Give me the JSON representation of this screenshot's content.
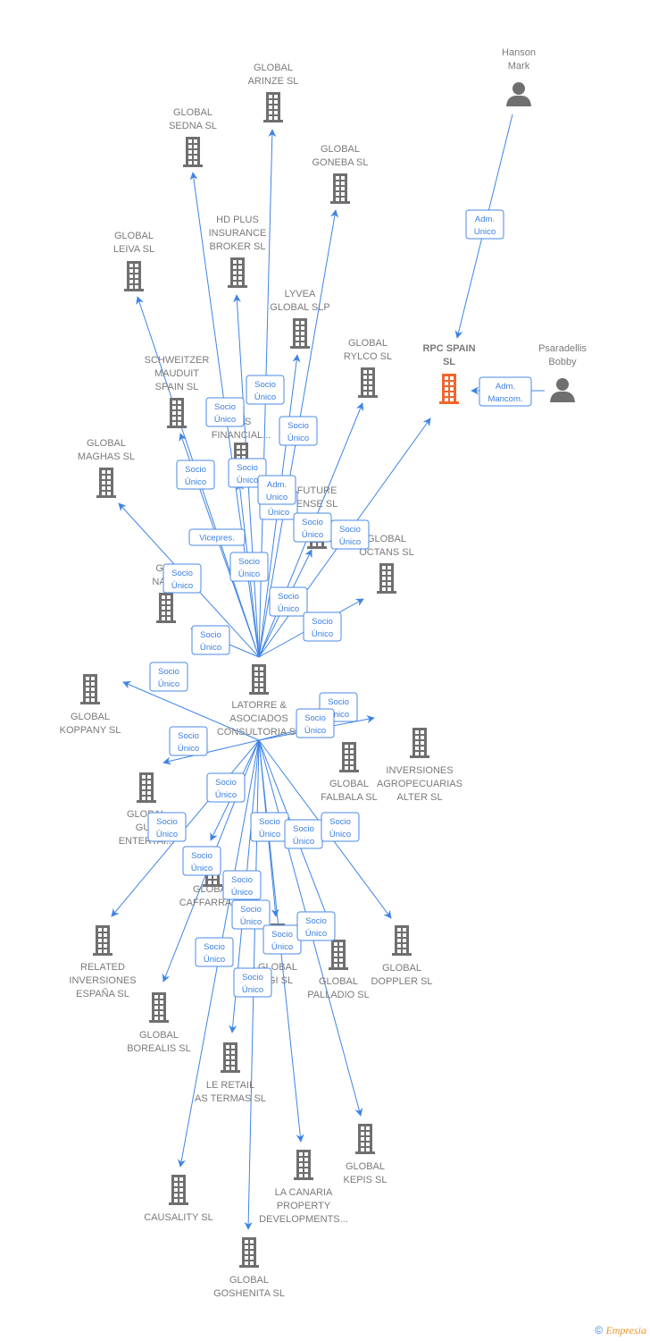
{
  "colors": {
    "edge": "#3f84e5",
    "company": "#6f6f6f",
    "highlight": "#f2652d",
    "person": "#6f6f6f"
  },
  "nodes": [
    {
      "id": "hub",
      "type": "company-icon",
      "lines": [
        "LATORRE &",
        "ASOCIADOS",
        "CONSULTORIA SL"
      ]
    },
    {
      "id": "arinze",
      "type": "company-icon",
      "lines": [
        "GLOBAL",
        "ARINZE  SL"
      ]
    },
    {
      "id": "sedna",
      "type": "company-icon",
      "lines": [
        "GLOBAL",
        "SEDNA  SL"
      ]
    },
    {
      "id": "goneba",
      "type": "company-icon",
      "lines": [
        "GLOBAL",
        "GONEBA  SL"
      ]
    },
    {
      "id": "hdplus",
      "type": "company-icon",
      "lines": [
        "HD PLUS",
        "INSURANCE",
        "BROKER  SL"
      ]
    },
    {
      "id": "leiva",
      "type": "company-icon",
      "lines": [
        "GLOBAL",
        "LEIVA  SL"
      ]
    },
    {
      "id": "lyvea",
      "type": "company-icon",
      "lines": [
        "LYVEA",
        "GLOBAL  SLP"
      ]
    },
    {
      "id": "rylco",
      "type": "company-icon",
      "lines": [
        "GLOBAL",
        "RYLCO  SL"
      ]
    },
    {
      "id": "rpc",
      "type": "company-icon-highlight",
      "lines": [
        "RPC  SPAIN",
        "SL"
      ]
    },
    {
      "id": "hanson",
      "type": "person-icon",
      "lines": [
        "Hanson",
        "Mark"
      ]
    },
    {
      "id": "psaradellis",
      "type": "person-icon",
      "lines": [
        "Psaradellis",
        "Bobby"
      ]
    },
    {
      "id": "schweitzer",
      "type": "company-icon",
      "lines": [
        "SCHWEITZER",
        "MAUDUIT",
        "SPAIN SL"
      ]
    },
    {
      "id": "financial",
      "type": "company-icon",
      "lines": [
        "O",
        "RES",
        "FINANCIAL..."
      ]
    },
    {
      "id": "maghas",
      "type": "company-icon",
      "lines": [
        "GLOBAL",
        "MAGHAS  SL"
      ]
    },
    {
      "id": "future",
      "type": "company-icon",
      "lines": [
        "FUTURE",
        "ENSE  SL"
      ]
    },
    {
      "id": "octans",
      "type": "company-icon",
      "lines": [
        "GLOBAL",
        "OCTANS  SL"
      ]
    },
    {
      "id": "nann",
      "type": "company-icon",
      "lines": [
        "GLO",
        "NANN"
      ]
    },
    {
      "id": "koppany",
      "type": "company-icon",
      "lines": [
        "GLOBAL",
        "KOPPANY  SL"
      ]
    },
    {
      "id": "alter",
      "type": "company-icon",
      "lines": [
        "INVERSIONES",
        "AGROPECUARIAS",
        "ALTER  SL"
      ]
    },
    {
      "id": "falbala",
      "type": "company-icon",
      "lines": [
        "GLOBAL",
        "FALBALA  SL"
      ]
    },
    {
      "id": "gud",
      "type": "company-icon",
      "lines": [
        "GLOBAL",
        "GUD",
        "ENTERTAI..."
      ]
    },
    {
      "id": "caffarra",
      "type": "company-icon",
      "lines": [
        "GLOBAL",
        "CAFFARRA SL"
      ]
    },
    {
      "id": "related",
      "type": "company-icon",
      "lines": [
        "RELATED",
        "INVERSIONES",
        "ESPAÑA  SL"
      ]
    },
    {
      "id": "doppler",
      "type": "company-icon",
      "lines": [
        "GLOBAL",
        "DOPPLER  SL"
      ]
    },
    {
      "id": "lgi",
      "type": "company-icon",
      "lines": [
        "GLOBAL",
        "LGI  SL"
      ]
    },
    {
      "id": "palladio",
      "type": "company-icon",
      "lines": [
        "GLOBAL",
        "PALLADIO  SL"
      ]
    },
    {
      "id": "borealis",
      "type": "company-icon",
      "lines": [
        "GLOBAL",
        "BOREALIS  SL"
      ]
    },
    {
      "id": "leretail",
      "type": "company-icon",
      "lines": [
        "LE RETAIL",
        "AS TERMAS  SL"
      ]
    },
    {
      "id": "kepis",
      "type": "company-icon",
      "lines": [
        "GLOBAL",
        "KEPIS  SL"
      ]
    },
    {
      "id": "canaria",
      "type": "company-icon",
      "lines": [
        "LA CANARIA",
        "PROPERTY",
        "DEVELOPMENTS..."
      ]
    },
    {
      "id": "causality",
      "type": "company-icon",
      "lines": [
        "CAUSALITY  SL"
      ]
    },
    {
      "id": "goshenita",
      "type": "company-icon",
      "lines": [
        "GLOBAL",
        "GOSHENITA SL"
      ]
    }
  ],
  "edges": [
    {
      "from": "hub",
      "to": "arinze"
    },
    {
      "from": "hub",
      "to": "sedna"
    },
    {
      "from": "hub",
      "to": "goneba"
    },
    {
      "from": "hub",
      "to": "hdplus"
    },
    {
      "from": "hub",
      "to": "leiva"
    },
    {
      "from": "hub",
      "to": "lyvea"
    },
    {
      "from": "hub",
      "to": "rylco"
    },
    {
      "from": "hub",
      "to": "rpc"
    },
    {
      "from": "hub",
      "to": "schweitzer"
    },
    {
      "from": "hub",
      "to": "financial"
    },
    {
      "from": "hub",
      "to": "maghas"
    },
    {
      "from": "hub",
      "to": "future"
    },
    {
      "from": "hub",
      "to": "octans"
    },
    {
      "from": "hub",
      "to": "nann"
    },
    {
      "from": "hub",
      "to": "koppany"
    },
    {
      "from": "hub",
      "to": "alter"
    },
    {
      "from": "hub",
      "to": "falbala"
    },
    {
      "from": "hub",
      "to": "gud"
    },
    {
      "from": "hub",
      "to": "caffarra"
    },
    {
      "from": "hub",
      "to": "related"
    },
    {
      "from": "hub",
      "to": "doppler"
    },
    {
      "from": "hub",
      "to": "lgi"
    },
    {
      "from": "hub",
      "to": "palladio"
    },
    {
      "from": "hub",
      "to": "borealis"
    },
    {
      "from": "hub",
      "to": "leretail"
    },
    {
      "from": "hub",
      "to": "kepis"
    },
    {
      "from": "hub",
      "to": "canaria"
    },
    {
      "from": "hub",
      "to": "causality"
    },
    {
      "from": "hub",
      "to": "goshenita"
    },
    {
      "from": "hanson",
      "to": "rpc"
    },
    {
      "from": "psaradellis",
      "to": "rpc"
    }
  ],
  "edge_labels": [
    [
      "Socio",
      "Único"
    ],
    [
      "Socio",
      "Único"
    ],
    [
      "Socio",
      "Único"
    ],
    [
      "Socio",
      "Único"
    ],
    [
      "Socio",
      "Único"
    ],
    [
      "Socio",
      "Único"
    ],
    [
      "Adm.",
      "Unico"
    ],
    [
      "Vicepres."
    ],
    [
      "Socio",
      "Único"
    ],
    [
      "Socio",
      "Único"
    ],
    [
      "Socio",
      "Único"
    ],
    [
      "Socio",
      "Único"
    ],
    [
      "Socio",
      "Único"
    ],
    [
      "Socio",
      "Único"
    ],
    [
      "Socio",
      "Único"
    ],
    [
      "Socio",
      "Único"
    ],
    [
      "Socio",
      "Único"
    ],
    [
      "Socio",
      "Único"
    ],
    [
      "Socio",
      "Único"
    ],
    [
      "Socio",
      "Único"
    ],
    [
      "Socio",
      "Único"
    ],
    [
      "Socio",
      "Único"
    ],
    [
      "Socio",
      "Único"
    ],
    [
      "Socio",
      "Único"
    ],
    [
      "Socio",
      "Único"
    ],
    [
      "Socio",
      "Único"
    ],
    [
      "Socio",
      "Único"
    ],
    [
      "Socio",
      "Único"
    ],
    [
      "Socio",
      "Único"
    ],
    [
      "Socio",
      "Único"
    ],
    [
      "Socio",
      "Único"
    ],
    [
      "Adm.",
      "Unico"
    ],
    [
      "Adm.",
      "Mancom."
    ]
  ],
  "footer": {
    "copyright": "©",
    "brand": "Empresia"
  }
}
